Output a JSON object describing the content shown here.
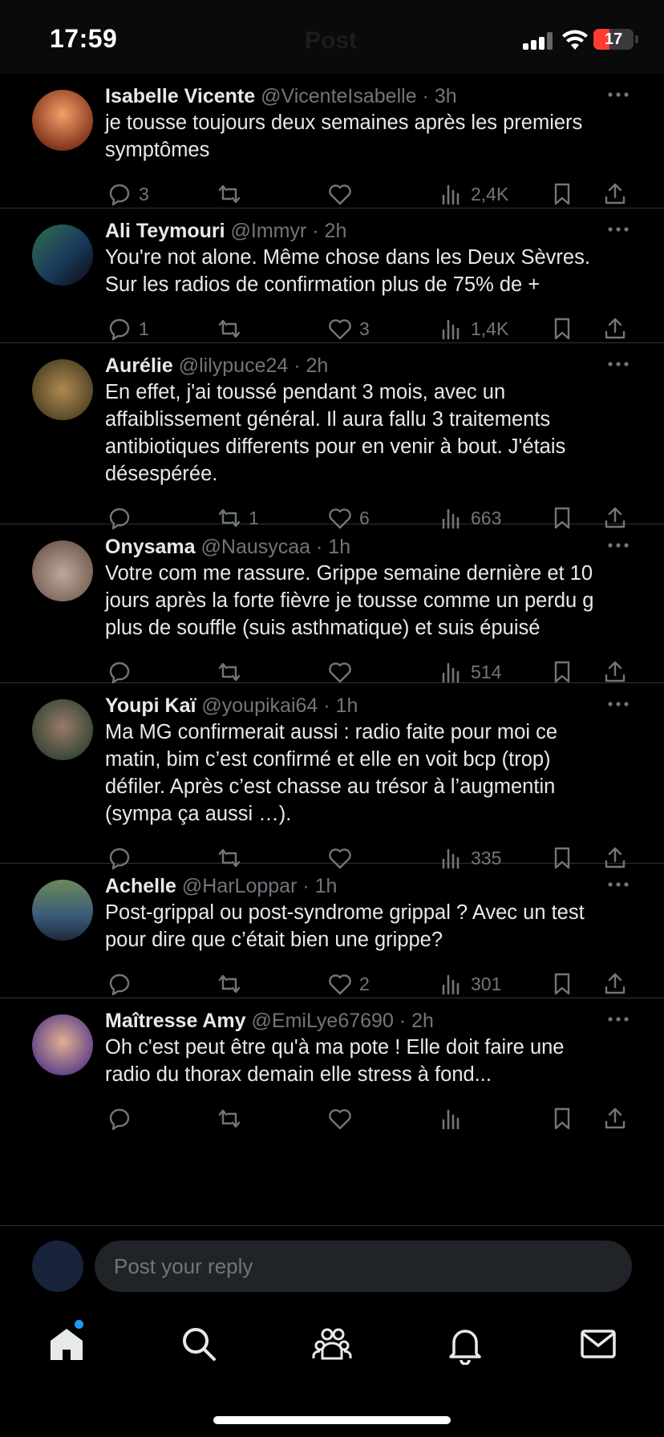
{
  "status_bar": {
    "time": "17:59",
    "battery": "17",
    "ghost_title": "Post"
  },
  "tweets": [
    {
      "name": "Isabelle Vicente",
      "handle": "@VicenteIsabelle",
      "time": "· 3h",
      "lines": [
        "je tousse toujours deux semaines après les premiers",
        "symptômes"
      ],
      "replies": "3",
      "reposts": "",
      "likes": "",
      "views": "2,4K"
    },
    {
      "name": "Ali Teymouri",
      "handle": "@Immyr",
      "time": "· 2h",
      "lines": [
        "You're not alone. Même chose dans les Deux Sèvres.",
        "Sur les radios de confirmation plus de 75% de +"
      ],
      "replies": "1",
      "reposts": "",
      "likes": "3",
      "views": "1,4K"
    },
    {
      "name": "Aurélie",
      "handle": "@lilypuce24",
      "time": "· 2h",
      "lines": [
        "En effet, j'ai toussé pendant 3 mois, avec un",
        "affaiblissement général. Il aura fallu 3 traitements",
        "antibiotiques differents pour en venir à bout. J'étais",
        "désespérée."
      ],
      "replies": "",
      "reposts": "1",
      "likes": "6",
      "views": "663"
    },
    {
      "name": "Onysama",
      "handle": "@Nausycaa",
      "time": "· 1h",
      "lines": [
        "Votre com me rassure. Grippe semaine dernière et 10",
        "jours après la forte fièvre je tousse comme un perdu g",
        "plus de souffle (suis asthmatique) et suis épuisé"
      ],
      "replies": "",
      "reposts": "",
      "likes": "",
      "views": "514"
    },
    {
      "name": "Youpi Kaï",
      "handle": "@youpikai64",
      "time": "· 1h",
      "lines": [
        "Ma MG confirmerait aussi : radio faite pour moi ce",
        "matin, bim c’est confirmé et elle en voit bcp (trop)",
        "défiler. Après c’est chasse au trésor à l’augmentin",
        "(sympa ça aussi …)."
      ],
      "replies": "",
      "reposts": "",
      "likes": "",
      "views": "335"
    },
    {
      "name": "Achelle",
      "handle": "@HarLoppar",
      "time": "· 1h",
      "lines": [
        "Post-grippal ou post-syndrome grippal ? Avec un test",
        "pour dire que c’était bien une grippe?"
      ],
      "replies": "",
      "reposts": "",
      "likes": "2",
      "views": "301"
    },
    {
      "name": "Maîtresse Amy",
      "handle": "@EmiLye67690",
      "time": "· 2h",
      "lines": [
        "Oh c'est peut être qu'à ma pote ! Elle doit faire une",
        "radio du thorax demain elle stress à fond..."
      ],
      "replies": "",
      "reposts": "",
      "likes": "",
      "views": ""
    }
  ],
  "reply_bar": {
    "placeholder": "Post your reply"
  },
  "colors": {
    "accent": "#1d9bf0",
    "muted": "#71767b",
    "text": "#e7e9ea",
    "divider": "#2f3336",
    "battery_low": "#ff3b30"
  },
  "icons": {
    "reply": "speech-bubble-icon",
    "repost": "repost-arrows-icon",
    "like": "heart-icon",
    "views": "bar-chart-icon",
    "bookmark": "bookmark-icon",
    "share": "share-upload-icon",
    "more": "ellipsis-icon",
    "tabs": [
      "home-icon",
      "search-icon",
      "communities-icon",
      "bell-icon",
      "mail-icon"
    ]
  }
}
